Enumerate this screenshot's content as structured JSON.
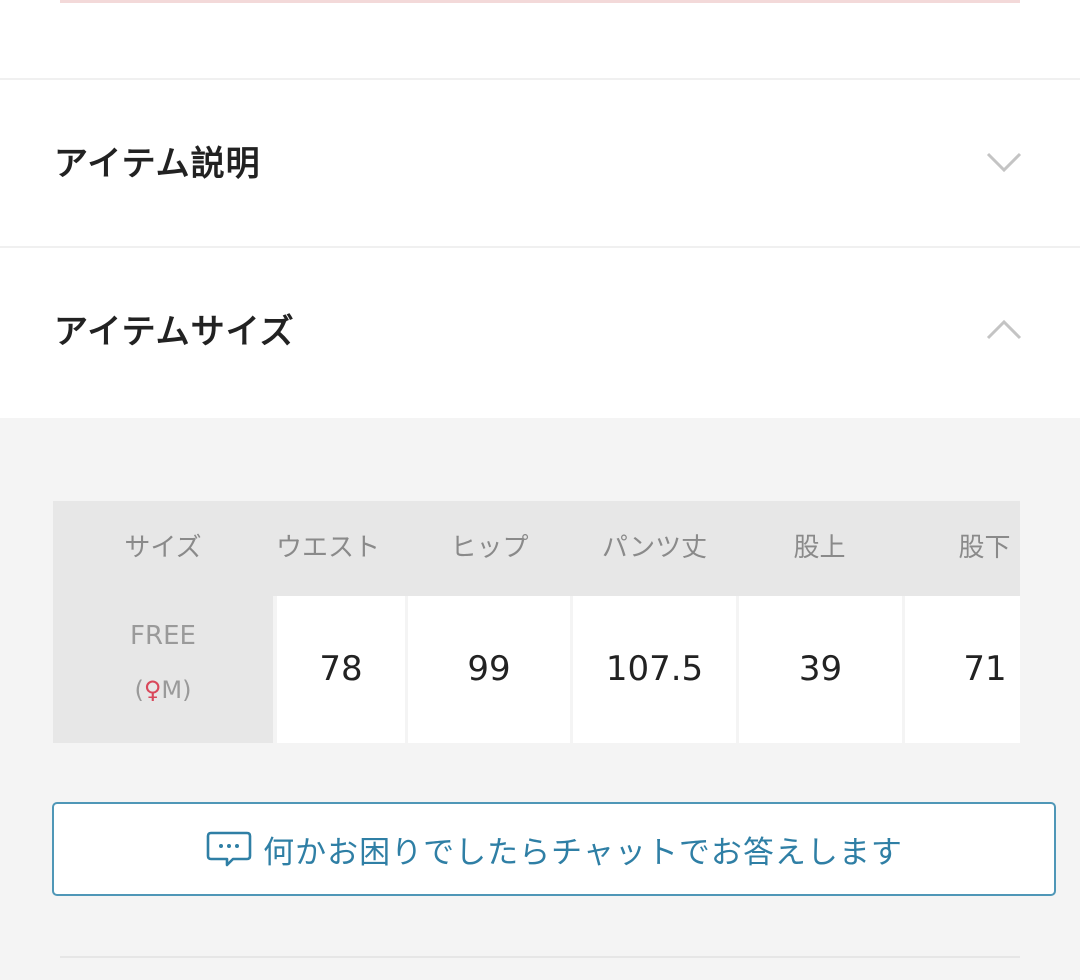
{
  "accordion": {
    "description": {
      "title": "アイテム説明",
      "state": "collapsed",
      "icon": "chevron-down-icon"
    },
    "size": {
      "title": "アイテムサイズ",
      "state": "expanded",
      "icon": "chevron-up-icon"
    }
  },
  "size_table": {
    "columns": [
      "サイズ",
      "ウエスト",
      "ヒップ",
      "パンツ丈",
      "股上",
      "股下"
    ],
    "row": {
      "size_label": "FREE",
      "model_prefix": "(",
      "model_icon": "person-icon",
      "model_size": "M",
      "model_suffix": ")",
      "values": [
        "78",
        "99",
        "107.5",
        "39",
        "71"
      ]
    }
  },
  "chat": {
    "label": "何かお困りでしたらチャットでお答えします",
    "icon": "chat-bubble-icon"
  },
  "colors": {
    "accent": "#2f7fa5",
    "border": "#4f97b7",
    "model_icon": "#d9485b"
  }
}
